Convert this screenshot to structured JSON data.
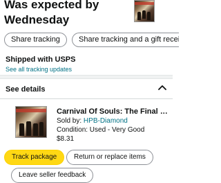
{
  "header": {
    "headline": "Was expected by Wednesday"
  },
  "actions": {
    "share_tracking": "Share tracking",
    "share_tracking_gift": "Share tracking and a gift recei"
  },
  "shipping": {
    "carrier_line": "Shipped with USPS",
    "tracking_link": "See all tracking updates"
  },
  "details": {
    "label": "See details",
    "chevron_icon": "chevron-up-icon"
  },
  "product": {
    "title": "Carnival Of Souls: The Final S...",
    "sold_by_prefix": "Sold by: ",
    "seller": "HPB-Diamond",
    "condition": "Condition: Used - Very Good",
    "price": "$8.31"
  },
  "buttons": {
    "track_package": "Track package",
    "return_replace": "Return or replace items",
    "leave_feedback": "Leave seller feedback"
  },
  "colors": {
    "link": "#007185",
    "primary_button": "#ffd814",
    "divider": "#f0f2f2"
  }
}
